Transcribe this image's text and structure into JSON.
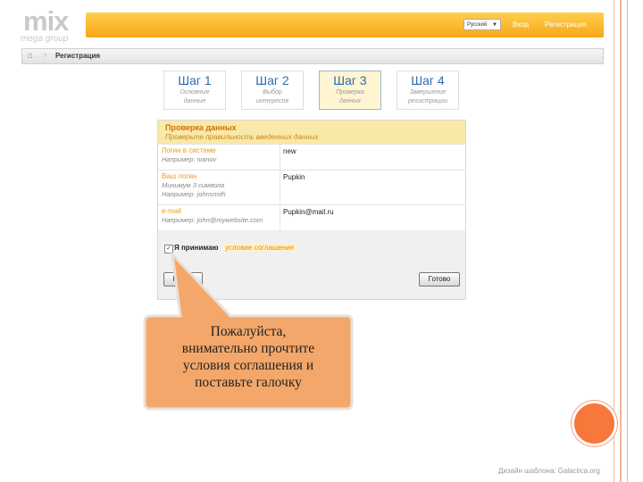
{
  "logo": {
    "main": "mix",
    "sub": "mega group"
  },
  "header": {
    "language": "Русский",
    "login": "Вход",
    "register": "Регистрация"
  },
  "breadcrumb": {
    "label": "Регистрация"
  },
  "steps": [
    {
      "title": "Шаг 1",
      "desc1": "Основные",
      "desc2": "данные"
    },
    {
      "title": "Шаг 2",
      "desc1": "Выбор",
      "desc2": "интересов"
    },
    {
      "title": "Шаг 3",
      "desc1": "Проверка",
      "desc2": "данных"
    },
    {
      "title": "Шаг 4",
      "desc1": "Завершение",
      "desc2": "регистрации"
    }
  ],
  "form": {
    "title": "Проверка данных",
    "subtitle": "Проверьте правильность введенных данных",
    "rows": [
      {
        "label": "Логин в системе",
        "hint1": "Например: ivanov",
        "hint2": "",
        "value": "new"
      },
      {
        "label": "Ваш логин",
        "hint1": "Минимум 3 символа",
        "hint2": "Например: johnsmith",
        "value": "Pupkin"
      },
      {
        "label": "e-mail",
        "hint1": "Например: john@mywebsite.com",
        "hint2": "",
        "value": "Pupkin@mail.ru"
      }
    ],
    "agree_text": "Я принимаю",
    "agree_link": "условие соглашения",
    "back_button": "Назад",
    "done_button": "Готово"
  },
  "callout": {
    "line1": "Пожалуйста,",
    "line2": "внимательно прочтите",
    "line3": "условия соглашения и",
    "line4": "поставьте галочку"
  },
  "footer": "Дизайн шаблона: Galactica.org"
}
